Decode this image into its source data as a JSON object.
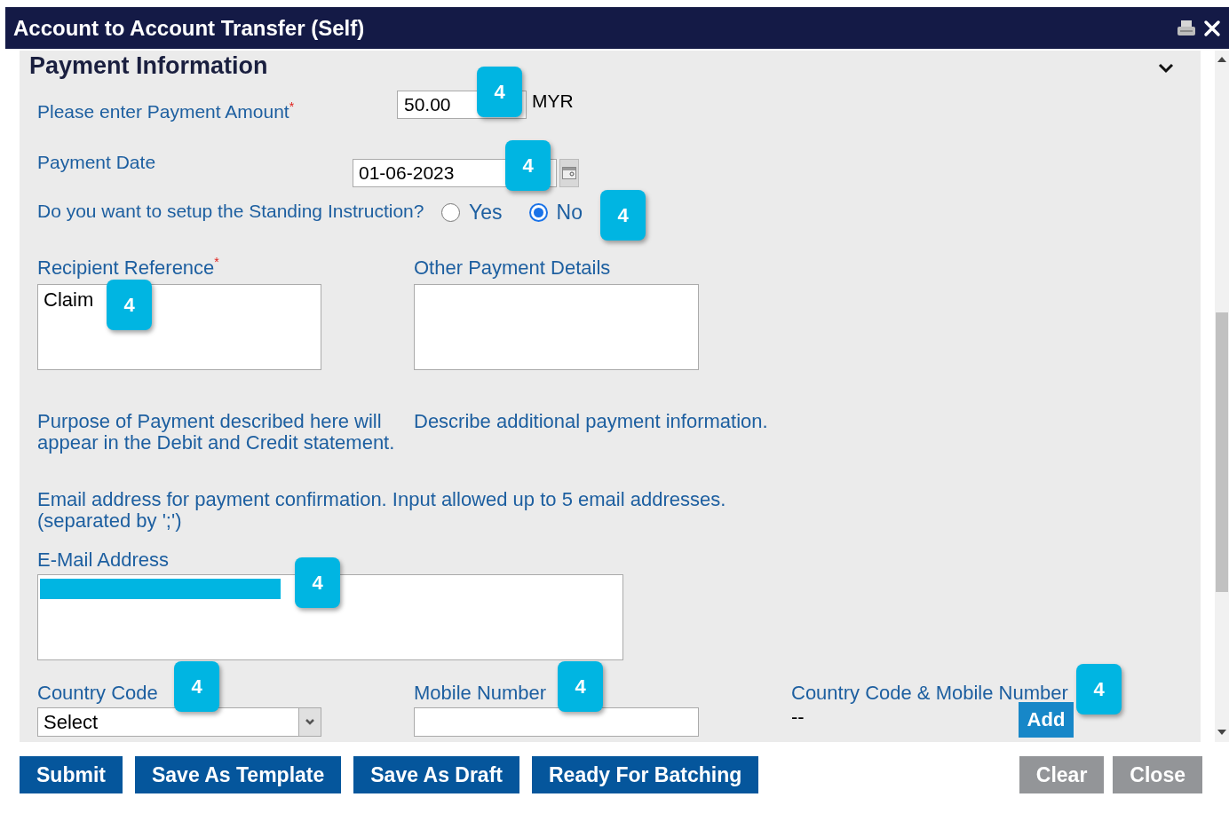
{
  "window": {
    "title": "Account to Account Transfer (Self)"
  },
  "section": {
    "title": "Payment Information",
    "expanded": true
  },
  "amount": {
    "label": "Please enter Payment Amount",
    "required_mark": "*",
    "value": "50.00",
    "currency": "MYR"
  },
  "date": {
    "label": "Payment Date",
    "value": "01-06-2023"
  },
  "standing_instruction": {
    "label": "Do you want to setup the Standing Instruction?",
    "options": [
      {
        "label": "Yes",
        "selected": false
      },
      {
        "label": "No",
        "selected": true
      }
    ]
  },
  "recipient_reference": {
    "label": "Recipient Reference",
    "required_mark": "*",
    "value": "Claim",
    "hint": "Purpose of Payment described here will appear in the Debit and Credit statement."
  },
  "other_details": {
    "label": "Other Payment Details",
    "hint": "Describe additional payment information."
  },
  "email": {
    "hint": "Email address for payment confirmation. Input allowed up to 5 email addresses. (separated by ';')",
    "label": "E-Mail Address",
    "redacted": true
  },
  "country_code": {
    "label": "Country Code",
    "value": "Select"
  },
  "mobile": {
    "label": "Mobile Number"
  },
  "combined": {
    "label": "Country Code & Mobile Number",
    "value": "--",
    "button": "Add"
  },
  "actions": [
    {
      "label": "Submit",
      "kind": "primary"
    },
    {
      "label": "Save As Template",
      "kind": "primary"
    },
    {
      "label": "Save As Draft",
      "kind": "primary"
    },
    {
      "label": "Ready For Batching",
      "kind": "primary"
    },
    {
      "label": "Clear",
      "kind": "secondary"
    },
    {
      "label": "Close",
      "kind": "secondary"
    }
  ],
  "callouts": [
    "4",
    "4",
    "4",
    "4",
    "4",
    "4",
    "4",
    "4"
  ]
}
